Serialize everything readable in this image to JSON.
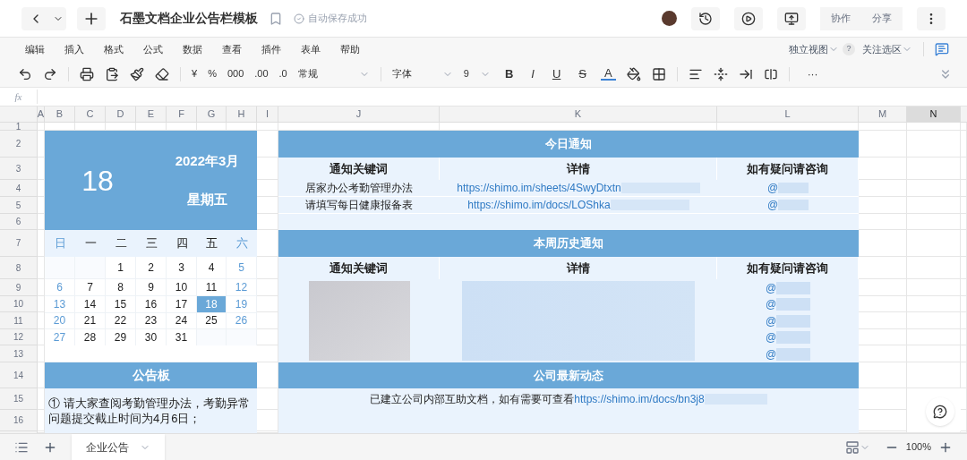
{
  "window": {
    "title": "石墨文档企业公告栏模板",
    "save_status": "自动保存成功",
    "buttons": [
      "协作",
      "分享"
    ]
  },
  "menu": [
    "编辑",
    "插入",
    "格式",
    "公式",
    "数据",
    "查看",
    "插件",
    "表单",
    "帮助"
  ],
  "menu_right": {
    "view": "独立视图",
    "help": "?",
    "follow": "关注选区"
  },
  "toolbar": {
    "number_items": [
      "¥",
      "%",
      "000",
      ".00",
      ".0"
    ],
    "number_format": "常规",
    "font": "字体",
    "font_size": "9",
    "style_items": [
      "B",
      "I",
      "U",
      "S",
      "A"
    ],
    "more": "···"
  },
  "formula_bar": {
    "label": "fx"
  },
  "columns": [
    {
      "label": "A",
      "selected": false
    },
    {
      "label": "B",
      "selected": false
    },
    {
      "label": "C",
      "selected": false
    },
    {
      "label": "D",
      "selected": false
    },
    {
      "label": "E",
      "selected": false
    },
    {
      "label": "F",
      "selected": false
    },
    {
      "label": "G",
      "selected": false
    },
    {
      "label": "H",
      "selected": false
    },
    {
      "label": "I",
      "selected": false
    },
    {
      "label": "J",
      "selected": false
    },
    {
      "label": "K",
      "selected": false
    },
    {
      "label": "L",
      "selected": false
    },
    {
      "label": "M",
      "selected": false
    },
    {
      "label": "N",
      "selected": true
    }
  ],
  "rows": [
    "1",
    "2",
    "3",
    "4",
    "5",
    "6",
    "7",
    "8",
    "9",
    "10",
    "11",
    "12",
    "13",
    "14",
    "15",
    "16"
  ],
  "calendar": {
    "day": "18",
    "month": "2022年3月",
    "weekday": "星期五",
    "weekdays": [
      {
        "label": "日",
        "weekend": true
      },
      {
        "label": "一",
        "weekend": false
      },
      {
        "label": "二",
        "weekend": false
      },
      {
        "label": "三",
        "weekend": false
      },
      {
        "label": "四",
        "weekend": false
      },
      {
        "label": "五",
        "weekend": false
      },
      {
        "label": "六",
        "weekend": true
      }
    ],
    "weeks": [
      {
        "days": [
          {
            "kind": "blank"
          },
          {
            "kind": "blank"
          },
          {
            "text": "1",
            "weekend": false,
            "selected": false
          },
          {
            "text": "2",
            "weekend": false,
            "selected": false
          },
          {
            "text": "3",
            "weekend": false,
            "selected": false
          },
          {
            "text": "4",
            "weekend": false,
            "selected": false
          },
          {
            "text": "5",
            "weekend": true,
            "selected": false
          }
        ]
      },
      {
        "days": [
          {
            "text": "6",
            "weekend": true,
            "selected": false
          },
          {
            "text": "7",
            "weekend": false,
            "selected": false
          },
          {
            "text": "8",
            "weekend": false,
            "selected": false
          },
          {
            "text": "9",
            "weekend": false,
            "selected": false
          },
          {
            "text": "10",
            "weekend": false,
            "selected": false
          },
          {
            "text": "11",
            "weekend": false,
            "selected": false
          },
          {
            "text": "12",
            "weekend": true,
            "selected": false
          }
        ]
      },
      {
        "days": [
          {
            "text": "13",
            "weekend": true,
            "selected": false
          },
          {
            "text": "14",
            "weekend": false,
            "selected": false
          },
          {
            "text": "15",
            "weekend": false,
            "selected": false
          },
          {
            "text": "16",
            "weekend": false,
            "selected": false
          },
          {
            "text": "17",
            "weekend": false,
            "selected": false
          },
          {
            "text": "18",
            "weekend": false,
            "selected": true
          },
          {
            "text": "19",
            "weekend": true,
            "selected": false
          }
        ]
      },
      {
        "days": [
          {
            "text": "20",
            "weekend": true,
            "selected": false
          },
          {
            "text": "21",
            "weekend": false,
            "selected": false
          },
          {
            "text": "22",
            "weekend": false,
            "selected": false
          },
          {
            "text": "23",
            "weekend": false,
            "selected": false
          },
          {
            "text": "24",
            "weekend": false,
            "selected": false
          },
          {
            "text": "25",
            "weekend": false,
            "selected": false
          },
          {
            "text": "26",
            "weekend": true,
            "selected": false
          }
        ]
      },
      {
        "days": [
          {
            "text": "27",
            "weekend": true,
            "selected": false
          },
          {
            "text": "28",
            "weekend": false,
            "selected": false
          },
          {
            "text": "29",
            "weekend": false,
            "selected": false
          },
          {
            "text": "30",
            "weekend": false,
            "selected": false
          },
          {
            "text": "31",
            "weekend": false,
            "selected": false
          },
          {
            "kind": "blank"
          },
          {
            "kind": "blank"
          }
        ]
      }
    ]
  },
  "notice_board": {
    "title": "公告板",
    "items": [
      "① 请大家查阅考勤管理办法，考勤异常问题提交截止时间为4月6日；"
    ]
  },
  "today": {
    "title": "今日通知",
    "columns": [
      "通知关键词",
      "详情",
      "如有疑问请咨询"
    ],
    "rows": [
      {
        "keyword": "居家办公考勤管理办法",
        "link": "https://shimo.im/sheets/4SwyDtxtn",
        "contact": "@"
      },
      {
        "keyword": "请填写每日健康报备表",
        "link": "https://shimo.im/docs/LOShka",
        "contact": "@"
      }
    ]
  },
  "history": {
    "title": "本周历史通知",
    "columns": [
      "通知关键词",
      "详情",
      "如有疑问请咨询"
    ],
    "contacts": [
      "@",
      "@",
      "@",
      "@",
      "@"
    ]
  },
  "news": {
    "title": "公司最新动态",
    "text": "已建立公司内部互助文档，如有需要可查看",
    "link": "https://shimo.im/docs/bn3j8"
  },
  "sheet_tabs": [
    {
      "label": "企业公告",
      "selected": true
    }
  ],
  "zoom": "100%"
}
